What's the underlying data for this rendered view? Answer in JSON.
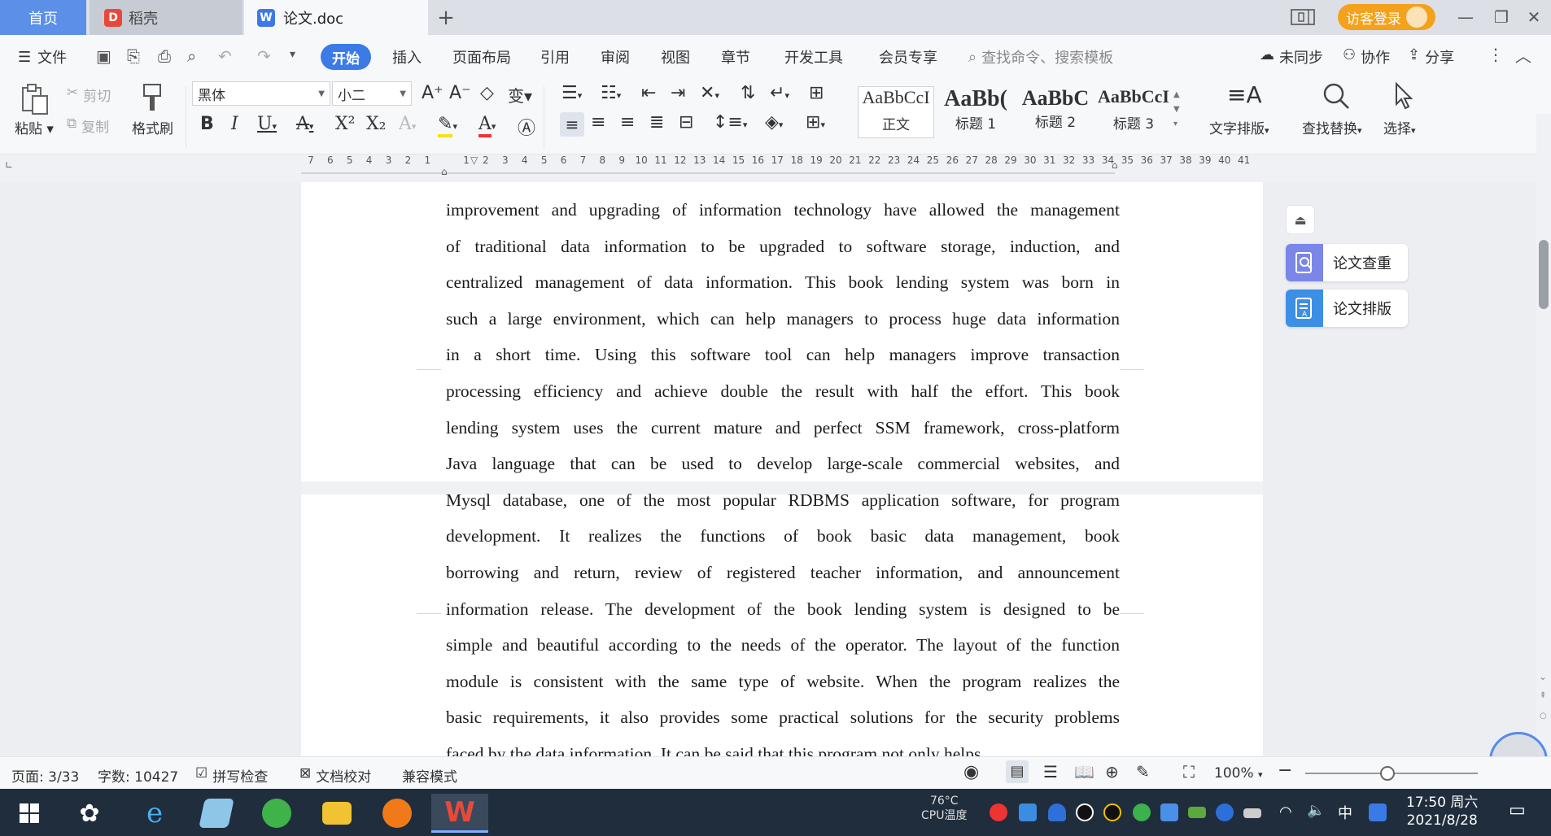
{
  "titlebar": {
    "tabs": [
      {
        "label": "首页"
      },
      {
        "label": "稻壳"
      },
      {
        "label": "论文.doc"
      }
    ],
    "new_tab": "+",
    "visitor_login": "访客登录"
  },
  "menubar": {
    "file": "文件",
    "items": [
      "开始",
      "插入",
      "页面布局",
      "引用",
      "审阅",
      "视图",
      "章节",
      "开发工具",
      "会员专享"
    ],
    "search_placeholder": "查找命令、搜索模板",
    "sync": "未同步",
    "collab": "协作",
    "share": "分享"
  },
  "ribbon": {
    "paste": "粘贴",
    "cut": "剪切",
    "copy": "复制",
    "format_painter": "格式刷",
    "font_name": "黑体",
    "font_size": "小二",
    "styles": [
      {
        "sample": "AaBbCcI",
        "name": "正文"
      },
      {
        "sample": "AaBb(",
        "name": "标题 1"
      },
      {
        "sample": "AaBbC",
        "name": "标题 2"
      },
      {
        "sample": "AaBbCcI",
        "name": "标题 3"
      }
    ],
    "text_layout": "文字排版",
    "find_replace": "查找替换",
    "select": "选择"
  },
  "ruler": {
    "numbers": [
      "7",
      "6",
      "5",
      "4",
      "3",
      "2",
      "1",
      "",
      "1",
      "2",
      "3",
      "4",
      "5",
      "6",
      "7",
      "8",
      "9",
      "10",
      "11",
      "12",
      "13",
      "14",
      "15",
      "16",
      "17",
      "18",
      "19",
      "20",
      "21",
      "22",
      "23",
      "24",
      "25",
      "26",
      "27",
      "28",
      "29",
      "30",
      "31",
      "32",
      "33",
      "34",
      "35",
      "36",
      "37",
      "38",
      "39",
      "40",
      "41"
    ]
  },
  "document": {
    "lines": [
      "improvement and upgrading of information technology have allowed the management",
      "of traditional data information to be upgraded to software storage, induction, and",
      "centralized management of data information. This book lending system was born in",
      "such a large environment, which can help managers to process huge data information",
      "in a short time. Using this software tool can help managers improve transaction",
      "processing efficiency and achieve double the result with half the effort. This book",
      "lending system uses the current mature and perfect SSM framework, cross-platform",
      "Java language that can be used to develop large-scale commercial websites, and",
      "Mysql database, one of the most popular RDBMS application software, for program",
      "development. It realizes the functions of book basic data management, book",
      "borrowing and return, review of registered teacher information, and announcement",
      "information release. The development of the book lending system is designed to be",
      "simple and beautiful according to the needs of the operator. The layout of the function",
      "module is consistent with the same type of website. When the program realizes the",
      "basic requirements, it also provides some practical solutions for the security problems",
      "faced by the data information.   It can be said that this program not only helps"
    ]
  },
  "side_panel": {
    "check": "论文查重",
    "layout": "论文排版"
  },
  "statusbar": {
    "page": "页面: 3/33",
    "words": "字数: 10427",
    "spellcheck": "拼写检查",
    "proofread": "文档校对",
    "compat": "兼容模式",
    "zoom": "100%"
  },
  "taskbar": {
    "cpu_temp": "76°C",
    "cpu_label": "CPU温度",
    "ime": "中",
    "time": "17:50 周六",
    "date": "2021/8/28"
  },
  "colors": {
    "accent": "#3c7ae6",
    "visitor": "#f4a11c",
    "side_check": "#7b86e8",
    "side_layout": "#3d8fe6"
  }
}
